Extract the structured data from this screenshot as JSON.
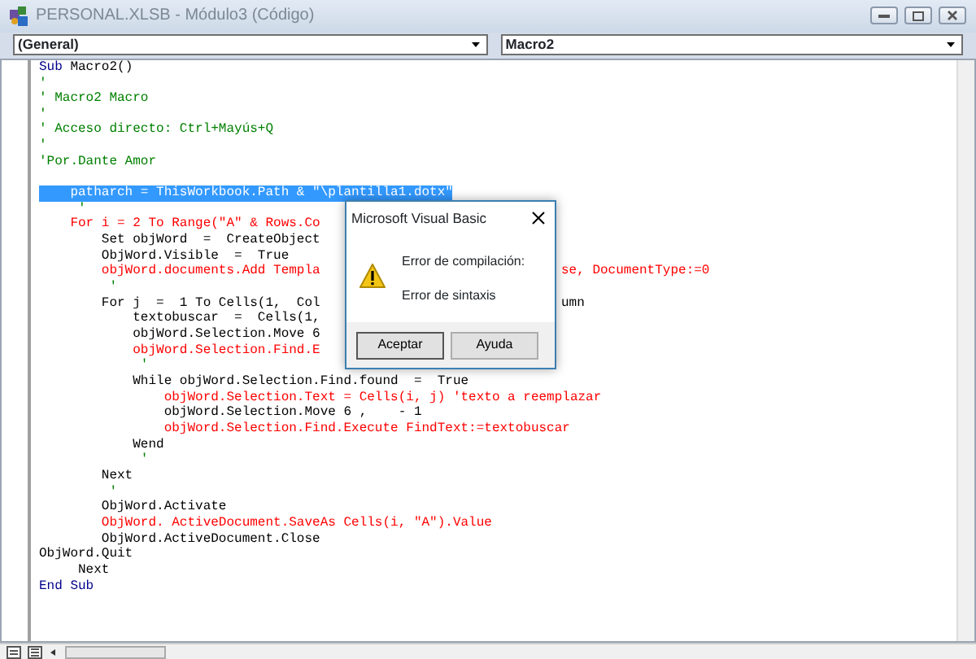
{
  "window": {
    "title": "PERSONAL.XLSB - Módulo3 (Código)"
  },
  "object_dropdown": {
    "value": "(General)"
  },
  "procedure_dropdown": {
    "value": "Macro2"
  },
  "code_lines": [
    {
      "selected": false,
      "segments": [
        {
          "text": "Sub",
          "kind": "keyword"
        },
        {
          "text": " Macro2()",
          "kind": "code"
        }
      ]
    },
    {
      "selected": false,
      "segments": [
        {
          "text": "'",
          "kind": "comment"
        }
      ]
    },
    {
      "selected": false,
      "segments": [
        {
          "text": "' Macro2 Macro",
          "kind": "comment"
        }
      ]
    },
    {
      "selected": false,
      "segments": [
        {
          "text": "'",
          "kind": "comment"
        }
      ]
    },
    {
      "selected": false,
      "segments": [
        {
          "text": "' Acceso directo: Ctrl+Mayús+Q",
          "kind": "comment"
        }
      ]
    },
    {
      "selected": false,
      "segments": [
        {
          "text": "'",
          "kind": "comment"
        }
      ]
    },
    {
      "selected": false,
      "segments": [
        {
          "text": "'Por.Dante Amor",
          "kind": "comment"
        }
      ]
    },
    {
      "selected": false
    },
    {
      "selected": true,
      "segments": [
        {
          "text": "    patharch = ThisWorkbook.Path & \"\\plantilla1.dotx\"",
          "kind": "code"
        }
      ]
    },
    {
      "selected": false,
      "segments": [
        {
          "text": "     '",
          "kind": "comment"
        }
      ]
    },
    {
      "selected": false,
      "segments": [
        {
          "text": "    For i = 2 To Range(\"A\" & Rows.Co",
          "kind": "error"
        }
      ]
    },
    {
      "selected": false,
      "segments": [
        {
          "text": "        Set objWord  =  CreateObject",
          "kind": "code"
        }
      ]
    },
    {
      "selected": false,
      "segments": [
        {
          "text": "        ObjWord.Visible  =  True",
          "kind": "code"
        }
      ]
    },
    {
      "selected": false,
      "segments": [
        {
          "text": "        objWord.documents.Add Templa",
          "kind": "error"
        }
      ],
      "tail": {
        "text": "se, DocumentType:=0",
        "kind": "error"
      }
    },
    {
      "selected": false,
      "segments": [
        {
          "text": "         '",
          "kind": "comment"
        }
      ]
    },
    {
      "selected": false,
      "segments": [
        {
          "text": "        For j  =  1 To Cells(1,  Col",
          "kind": "code"
        }
      ],
      "tail": {
        "text": "umn",
        "kind": "code"
      }
    },
    {
      "selected": false,
      "segments": [
        {
          "text": "            textobuscar  =  Cells(1,",
          "kind": "code"
        }
      ]
    },
    {
      "selected": false,
      "segments": [
        {
          "text": "            objWord.Selection.Move 6",
          "kind": "code"
        }
      ]
    },
    {
      "selected": false,
      "segments": [
        {
          "text": "            objWord.Selection.Find.E",
          "kind": "error"
        }
      ]
    },
    {
      "selected": false,
      "segments": [
        {
          "text": "             '",
          "kind": "comment"
        }
      ]
    },
    {
      "selected": false,
      "segments": [
        {
          "text": "            While objWord.Selection.Find.found  =  True",
          "kind": "code"
        }
      ]
    },
    {
      "selected": false,
      "segments": [
        {
          "text": "                objWord.Selection.Text = Cells(i, j) 'texto a reemplazar",
          "kind": "error"
        }
      ]
    },
    {
      "selected": false,
      "segments": [
        {
          "text": "                objWord.Selection.Move 6 ,    - 1",
          "kind": "code"
        }
      ]
    },
    {
      "selected": false,
      "segments": [
        {
          "text": "                objWord.Selection.Find.Execute FindText:=textobuscar",
          "kind": "error"
        }
      ]
    },
    {
      "selected": false,
      "segments": [
        {
          "text": "            Wend",
          "kind": "code"
        }
      ]
    },
    {
      "selected": false,
      "segments": [
        {
          "text": "             '",
          "kind": "comment"
        }
      ]
    },
    {
      "selected": false,
      "segments": [
        {
          "text": "        Next",
          "kind": "code"
        }
      ]
    },
    {
      "selected": false,
      "segments": [
        {
          "text": "         '",
          "kind": "comment"
        }
      ]
    },
    {
      "selected": false,
      "segments": [
        {
          "text": "        ObjWord.Activate",
          "kind": "code"
        }
      ]
    },
    {
      "selected": false,
      "segments": [
        {
          "text": "        ObjWord. ActiveDocument.SaveAs Cells(i, \"A\").Value",
          "kind": "error"
        }
      ]
    },
    {
      "selected": false,
      "segments": [
        {
          "text": "        ObjWord.ActiveDocument.Close",
          "kind": "code"
        }
      ]
    },
    {
      "selected": false,
      "segments": [
        {
          "text": "ObjWord.Quit",
          "kind": "code"
        }
      ]
    },
    {
      "selected": false,
      "segments": [
        {
          "text": "     Next",
          "kind": "code"
        }
      ]
    },
    {
      "selected": false,
      "segments": [
        {
          "text": "End Sub",
          "kind": "keyword"
        }
      ]
    }
  ],
  "dialog": {
    "title": "Microsoft Visual Basic",
    "messages": [
      "Error de compilación:",
      "Error de sintaxis"
    ],
    "buttons": [
      "Aceptar",
      "Ayuda"
    ]
  }
}
